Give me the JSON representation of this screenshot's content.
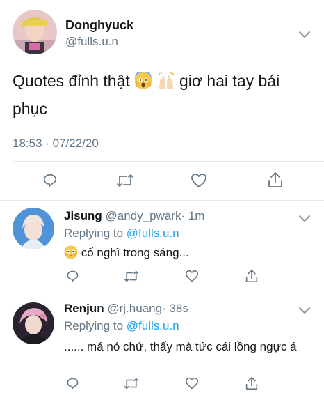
{
  "main_tweet": {
    "display_name": "Donghyuck",
    "handle": "@fulls.u.n",
    "text_before": "Quotes đỉnh thật ",
    "emoji_1": "face-screaming-in-fear",
    "emoji_2": "raising-hands",
    "text_after": " giơ hai tay bái phục",
    "timestamp": "18:53 · 07/22/20"
  },
  "replies": [
    {
      "display_name": "Jisung",
      "handle": "@andy_pwark",
      "age": "· 1m",
      "replying_label": "Replying to",
      "replying_to": "@fulls.u.n",
      "emoji": "flushed-face",
      "text": " cố nghĩ trong sáng..."
    },
    {
      "display_name": "Renjun",
      "handle": "@rj.huang",
      "age": "· 38s",
      "replying_label": "Replying to",
      "replying_to": "@fulls.u.n",
      "text": "...... má nó chứ, thấy mà tức cái lồng ngực á"
    }
  ],
  "actions": [
    "reply-icon",
    "retweet-icon",
    "like-icon",
    "share-icon"
  ],
  "colors": {
    "text": "#14171a",
    "secondary": "#657786",
    "link": "#1da1f2",
    "divider": "#e1e8ed",
    "icon": "#657786"
  }
}
